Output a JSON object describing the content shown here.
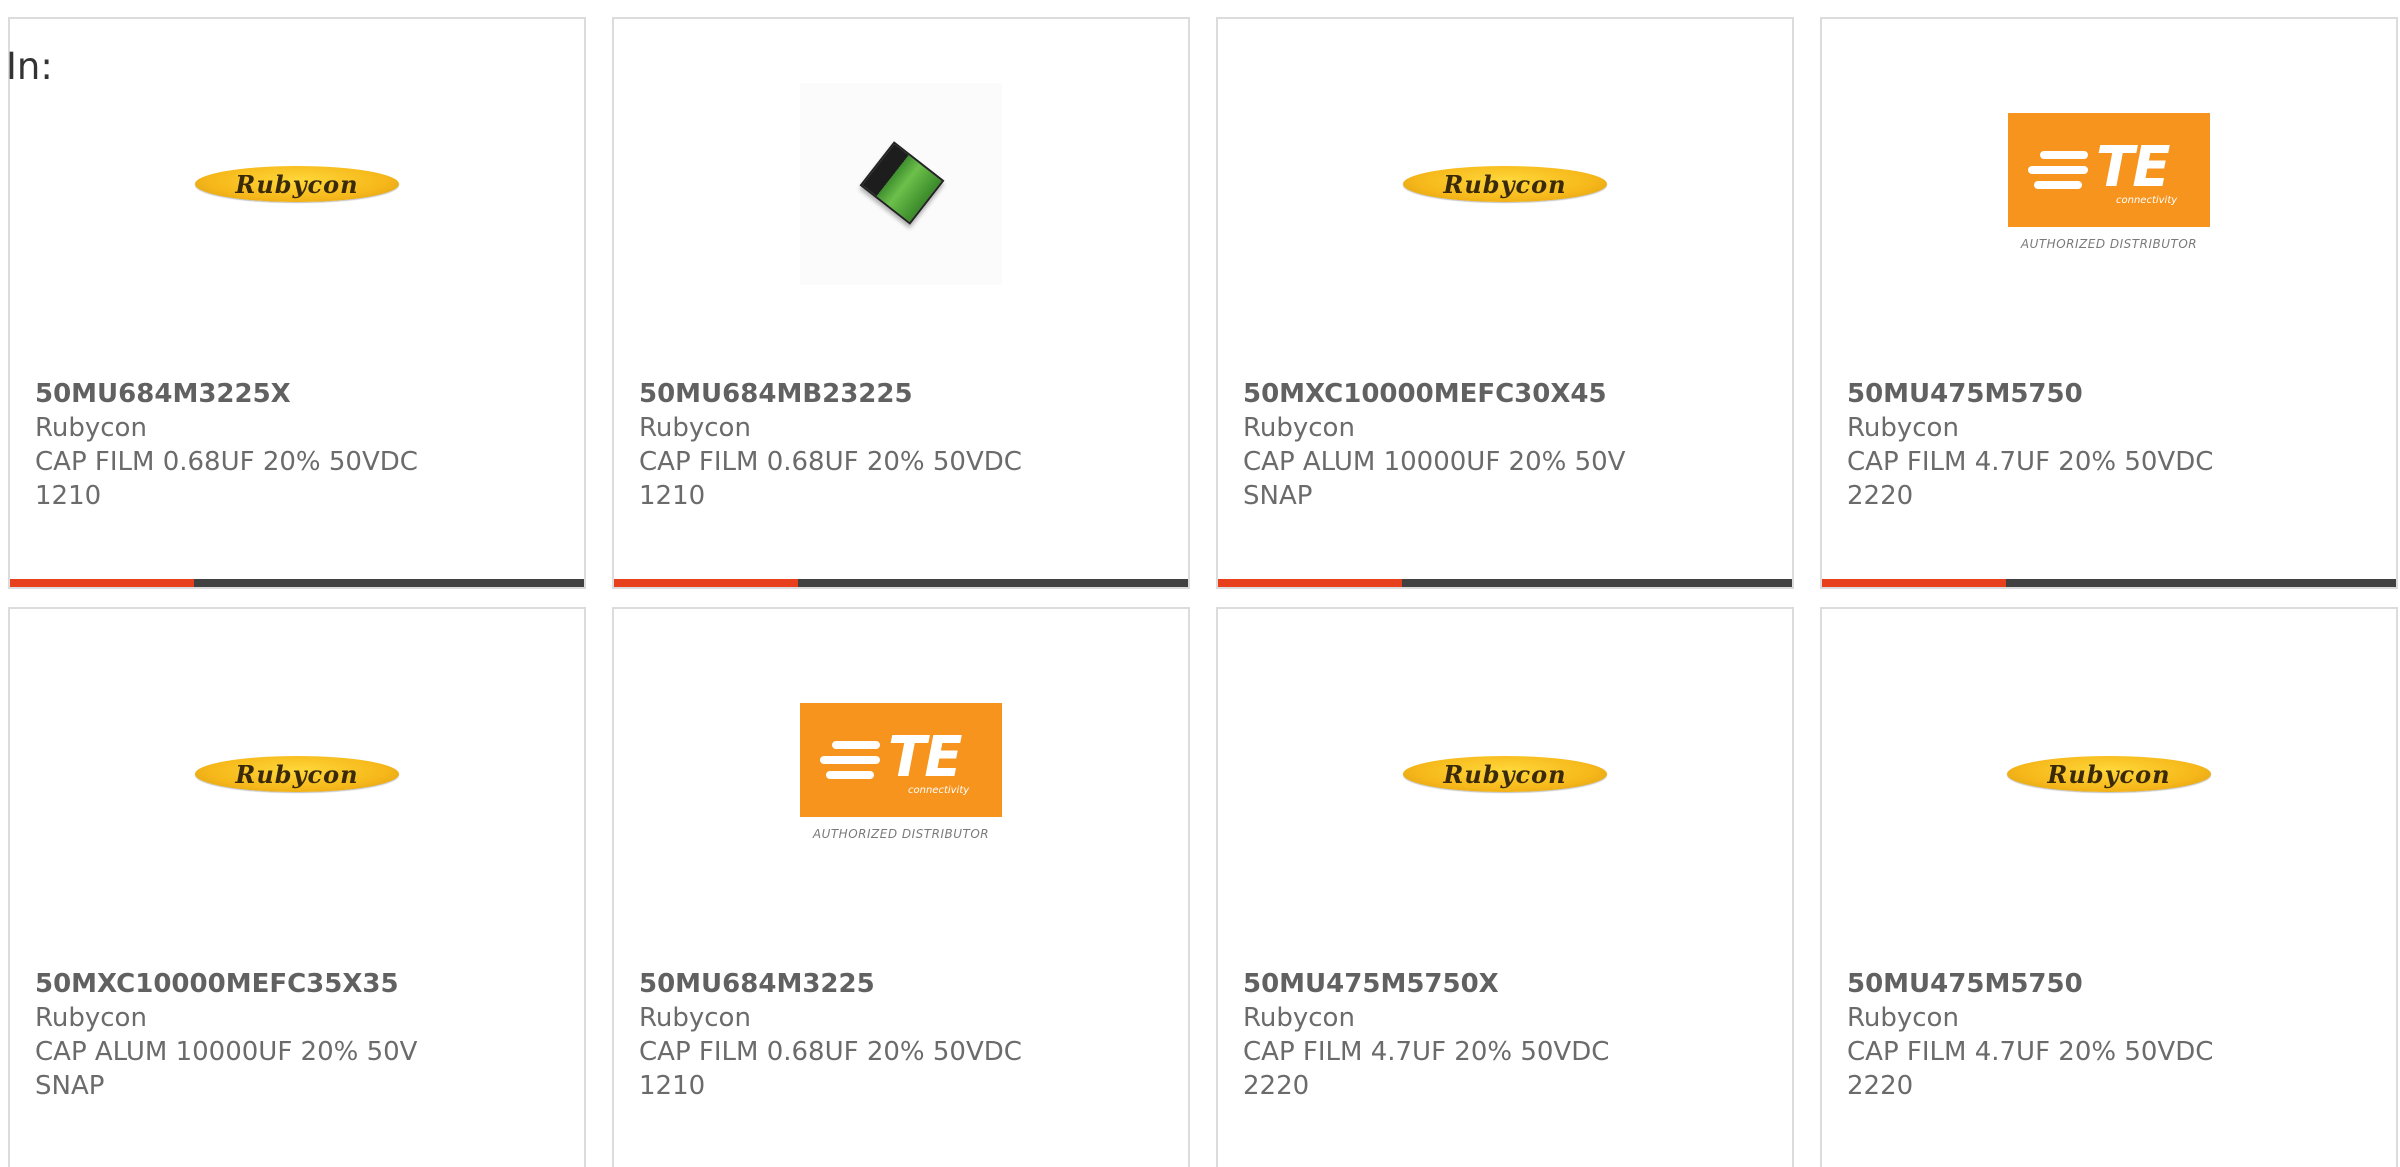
{
  "page": {
    "in_label": "In:"
  },
  "accent_color": "#e8401c",
  "bar_color": "#414141",
  "cards": [
    {
      "part_number": "50MU684M3225X",
      "manufacturer": "Rubycon",
      "description": "CAP FILM 0.68UF 20% 50VDC\n1210",
      "image": "rubycon-logo",
      "logo_text": "Rubycon"
    },
    {
      "part_number": "50MU684MB23225",
      "manufacturer": "Rubycon",
      "description": "CAP FILM 0.68UF 20% 50VDC\n1210",
      "image": "chip-photo"
    },
    {
      "part_number": "50MXC10000MEFC30X45",
      "manufacturer": "Rubycon",
      "description": "CAP ALUM 10000UF 20% 50V\nSNAP",
      "image": "rubycon-logo",
      "logo_text": "Rubycon"
    },
    {
      "part_number": "50MU475M5750",
      "manufacturer": "Rubycon",
      "description": "CAP FILM 4.7UF 20% 50VDC\n2220",
      "image": "te-logo",
      "logo_text": "TE",
      "logo_sub": "connectivity",
      "logo_auth": "AUTHORIZED DISTRIBUTOR"
    },
    {
      "part_number": "50MXC10000MEFC35X35",
      "manufacturer": "Rubycon",
      "description": "CAP ALUM 10000UF 20% 50V\nSNAP",
      "image": "rubycon-logo",
      "logo_text": "Rubycon"
    },
    {
      "part_number": "50MU684M3225",
      "manufacturer": "Rubycon",
      "description": "CAP FILM 0.68UF 20% 50VDC\n1210",
      "image": "te-logo",
      "logo_text": "TE",
      "logo_sub": "connectivity",
      "logo_auth": "AUTHORIZED DISTRIBUTOR"
    },
    {
      "part_number": "50MU475M5750X",
      "manufacturer": "Rubycon",
      "description": "CAP FILM 4.7UF 20% 50VDC\n2220",
      "image": "rubycon-logo",
      "logo_text": "Rubycon"
    },
    {
      "part_number": "50MU475M5750",
      "manufacturer": "Rubycon",
      "description": "CAP FILM 4.7UF 20% 50VDC\n2220",
      "image": "rubycon-logo",
      "logo_text": "Rubycon"
    }
  ],
  "progress_bars": [
    {
      "fraction": 0.32
    },
    {
      "fraction": 0.32
    },
    {
      "fraction": 0.32
    },
    {
      "fraction": 0.32
    }
  ]
}
